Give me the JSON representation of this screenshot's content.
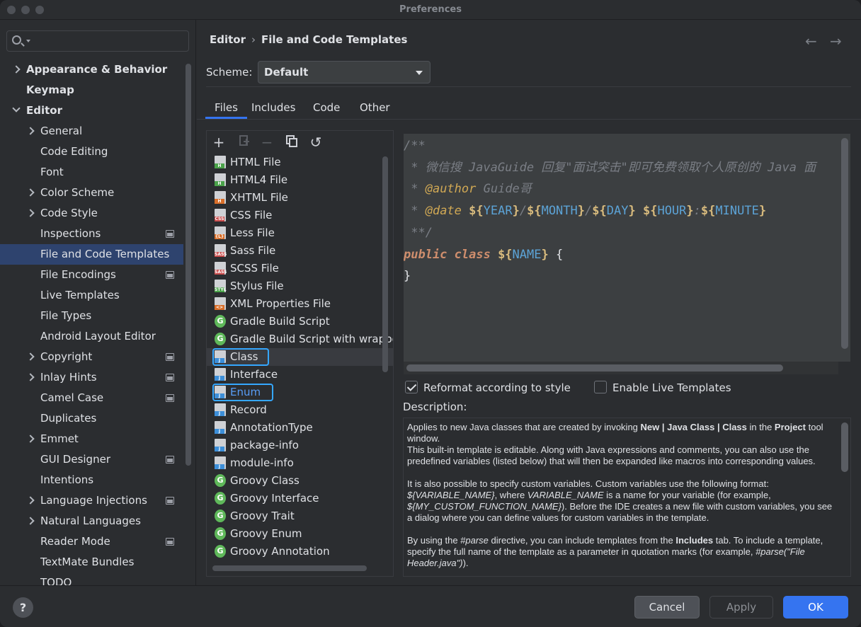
{
  "window": {
    "title": "Preferences"
  },
  "search": {
    "placeholder": ""
  },
  "sidebar": {
    "items": [
      {
        "label": "Appearance & Behavior",
        "level": 0,
        "chevron": "right",
        "bold": true
      },
      {
        "label": "Keymap",
        "level": 0,
        "chevron": "none",
        "bold": true
      },
      {
        "label": "Editor",
        "level": 0,
        "chevron": "down",
        "bold": true
      },
      {
        "label": "General",
        "level": 1,
        "chevron": "right"
      },
      {
        "label": "Code Editing",
        "level": 1,
        "chevron": "none"
      },
      {
        "label": "Font",
        "level": 1,
        "chevron": "none"
      },
      {
        "label": "Color Scheme",
        "level": 1,
        "chevron": "right"
      },
      {
        "label": "Code Style",
        "level": 1,
        "chevron": "right"
      },
      {
        "label": "Inspections",
        "level": 1,
        "chevron": "none",
        "project_icon": true
      },
      {
        "label": "File and Code Templates",
        "level": 1,
        "chevron": "none",
        "selected": true
      },
      {
        "label": "File Encodings",
        "level": 1,
        "chevron": "none",
        "project_icon": true
      },
      {
        "label": "Live Templates",
        "level": 1,
        "chevron": "none"
      },
      {
        "label": "File Types",
        "level": 1,
        "chevron": "none"
      },
      {
        "label": "Android Layout Editor",
        "level": 1,
        "chevron": "none"
      },
      {
        "label": "Copyright",
        "level": 1,
        "chevron": "right",
        "project_icon": true
      },
      {
        "label": "Inlay Hints",
        "level": 1,
        "chevron": "right",
        "project_icon": true
      },
      {
        "label": "Camel Case",
        "level": 1,
        "chevron": "none",
        "project_icon": true
      },
      {
        "label": "Duplicates",
        "level": 1,
        "chevron": "none"
      },
      {
        "label": "Emmet",
        "level": 1,
        "chevron": "right"
      },
      {
        "label": "GUI Designer",
        "level": 1,
        "chevron": "none",
        "project_icon": true
      },
      {
        "label": "Intentions",
        "level": 1,
        "chevron": "none"
      },
      {
        "label": "Language Injections",
        "level": 1,
        "chevron": "right",
        "project_icon": true
      },
      {
        "label": "Natural Languages",
        "level": 1,
        "chevron": "right"
      },
      {
        "label": "Reader Mode",
        "level": 1,
        "chevron": "none",
        "project_icon": true
      },
      {
        "label": "TextMate Bundles",
        "level": 1,
        "chevron": "none"
      },
      {
        "label": "TODO",
        "level": 1,
        "chevron": "none"
      }
    ]
  },
  "breadcrumb": {
    "parent": "Editor",
    "separator": "›",
    "current": "File and Code Templates"
  },
  "nav": {
    "back": "←",
    "forward": "→"
  },
  "scheme": {
    "label": "Scheme:",
    "value": "Default"
  },
  "tabs": [
    {
      "label": "Files",
      "active": true
    },
    {
      "label": "Includes"
    },
    {
      "label": "Code"
    },
    {
      "label": "Other"
    }
  ],
  "toolbar": {
    "add": "+",
    "remove": "−",
    "reset": "↺"
  },
  "files": [
    {
      "label": "HTML File",
      "icon": "doc",
      "badge": "H",
      "badge_color": "#4aa24a"
    },
    {
      "label": "HTML4 File",
      "icon": "doc",
      "badge": "H",
      "badge_color": "#4aa24a"
    },
    {
      "label": "XHTML File",
      "icon": "doc",
      "badge": "H",
      "badge_color": "#d96f2a"
    },
    {
      "label": "CSS File",
      "icon": "doc",
      "badge": "CSS",
      "badge_color": "#c94a4a"
    },
    {
      "label": "Less File",
      "icon": "doc",
      "badge": "{L}",
      "badge_color": "#d96f2a"
    },
    {
      "label": "Sass File",
      "icon": "doc",
      "badge": "SASS",
      "badge_color": "#c94a4a"
    },
    {
      "label": "SCSS File",
      "icon": "doc",
      "badge": "SASS",
      "badge_color": "#c94a4a"
    },
    {
      "label": "Stylus File",
      "icon": "doc",
      "badge": "STYL",
      "badge_color": "#4aa24a"
    },
    {
      "label": "XML Properties File",
      "icon": "doc",
      "badge": "<>",
      "badge_color": "#d96f2a"
    },
    {
      "label": "Gradle Build Script",
      "icon": "g",
      "badge": "G",
      "badge_color": "#5fb85a"
    },
    {
      "label": "Gradle Build Script with wrappe",
      "icon": "g",
      "badge": "G",
      "badge_color": "#5fb85a"
    },
    {
      "label": "Class",
      "icon": "doc",
      "badge": "J",
      "badge_color": "#3d8fd9",
      "selected": true,
      "highlight": true
    },
    {
      "label": "Interface",
      "icon": "doc",
      "badge": "J",
      "badge_color": "#3d8fd9"
    },
    {
      "label": "Enum",
      "icon": "doc",
      "badge": "J",
      "badge_color": "#3d8fd9",
      "highlight": true,
      "link_color": true
    },
    {
      "label": "Record",
      "icon": "doc",
      "badge": "J",
      "badge_color": "#3d8fd9"
    },
    {
      "label": "AnnotationType",
      "icon": "doc",
      "badge": "J",
      "badge_color": "#3d8fd9"
    },
    {
      "label": "package-info",
      "icon": "doc",
      "badge": "J",
      "badge_color": "#3d8fd9"
    },
    {
      "label": "module-info",
      "icon": "doc",
      "badge": "J",
      "badge_color": "#3d8fd9"
    },
    {
      "label": "Groovy Class",
      "icon": "g",
      "badge": "G",
      "badge_color": "#5fb85a"
    },
    {
      "label": "Groovy Interface",
      "icon": "g",
      "badge": "G",
      "badge_color": "#5fb85a"
    },
    {
      "label": "Groovy Trait",
      "icon": "g",
      "badge": "G",
      "badge_color": "#5fb85a"
    },
    {
      "label": "Groovy Enum",
      "icon": "g",
      "badge": "G",
      "badge_color": "#5fb85a"
    },
    {
      "label": "Groovy Annotation",
      "icon": "g",
      "badge": "G",
      "badge_color": "#5fb85a"
    }
  ],
  "editor": {
    "lines": [
      [
        {
          "t": "/**",
          "c": "c-cmt"
        }
      ],
      [
        {
          "t": " * 微信搜 JavaGuide 回复\"面试突击\"即可免费领取个人原创的 Java 面",
          "c": "c-cmt"
        }
      ],
      [
        {
          "t": " * ",
          "c": "c-cmt"
        },
        {
          "t": "@author",
          "c": "c-tag"
        },
        {
          "t": " Guide哥",
          "c": "c-cmt"
        }
      ],
      [
        {
          "t": " * ",
          "c": "c-cmt"
        },
        {
          "t": "@date",
          "c": "c-tag"
        },
        {
          "t": " ",
          "c": "c-cmt"
        },
        {
          "t": "${",
          "c": "c-dol"
        },
        {
          "t": "YEAR",
          "c": "c-var"
        },
        {
          "t": "}",
          "c": "c-dol"
        },
        {
          "t": "/",
          "c": "c-cmt"
        },
        {
          "t": "${",
          "c": "c-dol"
        },
        {
          "t": "MONTH",
          "c": "c-var"
        },
        {
          "t": "}",
          "c": "c-dol"
        },
        {
          "t": "/",
          "c": "c-cmt"
        },
        {
          "t": "${",
          "c": "c-dol"
        },
        {
          "t": "DAY",
          "c": "c-var"
        },
        {
          "t": "}",
          "c": "c-dol"
        },
        {
          "t": " ",
          "c": "c-cmt"
        },
        {
          "t": "${",
          "c": "c-dol"
        },
        {
          "t": "HOUR",
          "c": "c-var"
        },
        {
          "t": "}",
          "c": "c-dol"
        },
        {
          "t": ":",
          "c": "c-cmt"
        },
        {
          "t": "${",
          "c": "c-dol"
        },
        {
          "t": "MINUTE",
          "c": "c-var"
        },
        {
          "t": "}",
          "c": "c-dol"
        }
      ],
      [
        {
          "t": " **/",
          "c": "c-cmt"
        }
      ],
      [
        {
          "t": "public class ",
          "c": "c-kw"
        },
        {
          "t": "${",
          "c": "c-dol"
        },
        {
          "t": "NAME",
          "c": "c-var"
        },
        {
          "t": "}",
          "c": "c-dol"
        },
        {
          "t": " {",
          "c": "c-plain"
        }
      ],
      [
        {
          "t": "}",
          "c": "c-plain"
        }
      ]
    ]
  },
  "options": {
    "reformat": {
      "label": "Reformat according to style",
      "checked": true
    },
    "live_templates": {
      "label": "Enable Live Templates",
      "checked": false
    }
  },
  "description": {
    "label": "Description:",
    "paragraphs": [
      [
        {
          "t": "Applies to new Java classes that are created by invoking "
        },
        {
          "t": "New | Java Class | Class",
          "b": true
        },
        {
          "t": " in the "
        },
        {
          "t": "Project",
          "b": true
        },
        {
          "t": " tool window."
        },
        {
          "br": true
        },
        {
          "t": "This built-in template is editable. Along with Java expressions and comments, you can also use the predefined variables (listed below) that will then be expanded like macros into corresponding values."
        }
      ],
      [
        {
          "t": "It is also possible to specify custom variables. Custom variables use the following format: "
        },
        {
          "t": "${VARIABLE_NAME}",
          "i": true
        },
        {
          "t": ", where "
        },
        {
          "t": "VARIABLE_NAME",
          "i": true
        },
        {
          "t": " is a name for your variable (for example, "
        },
        {
          "t": "${MY_CUSTOM_FUNCTION_NAME}",
          "i": true
        },
        {
          "t": "). Before the IDE creates a new file with custom variables, you see a dialog where you can define values for custom variables in the template."
        }
      ],
      [
        {
          "t": "By using the "
        },
        {
          "t": "#parse",
          "i": true
        },
        {
          "t": " directive, you can include templates from the "
        },
        {
          "t": "Includes",
          "b": true
        },
        {
          "t": " tab. To include a template, specify the full name of the template as a parameter in quotation marks (for example, "
        },
        {
          "t": "#parse(\"File Header.java\")",
          "i": true
        },
        {
          "t": ")."
        }
      ]
    ]
  },
  "footer": {
    "help": "?",
    "cancel": "Cancel",
    "apply": "Apply",
    "ok": "OK"
  },
  "colors": {
    "accent": "#3574f0",
    "selection": "#2e436e",
    "highlight_box": "#35a7ff",
    "link": "#589df6"
  }
}
